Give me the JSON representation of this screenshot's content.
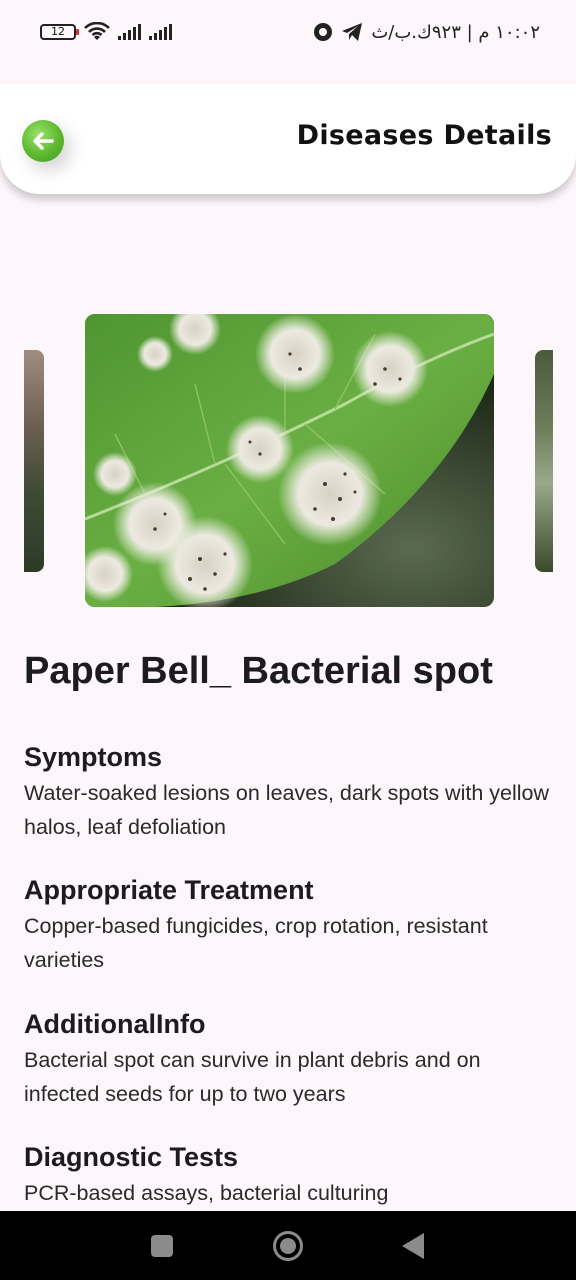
{
  "status_bar": {
    "battery": "12",
    "time_text": "١٠:٠٢ م | ٩٢٣ك.ب/ث",
    "icons": [
      "battery-icon",
      "wifi-icon",
      "signal-icon",
      "signal-icon",
      "vpn-icon",
      "telegram-icon"
    ]
  },
  "header": {
    "title": "Diseases Details",
    "back_icon": "arrow-left-icon",
    "accent": "#5cb82e"
  },
  "carousel": {
    "main_image": "leaf-disease-photo",
    "colors": {
      "leaf": "#5c9e3a",
      "spot": "#e8e6dc",
      "background": "#1e2a18"
    }
  },
  "disease": {
    "name": "Paper Bell_ Bacterial spot",
    "sections": [
      {
        "heading": "Symptoms",
        "text": "Water-soaked lesions on leaves, dark spots with yellow halos, leaf defoliation"
      },
      {
        "heading": "Appropriate Treatment",
        "text": "Copper-based fungicides, crop rotation, resistant varieties"
      },
      {
        "heading": "AdditionalInfo",
        "text": "Bacterial spot can survive in plant debris and on infected seeds for up to two years"
      },
      {
        "heading": "Diagnostic Tests",
        "text": "PCR-based assays, bacterial culturing"
      }
    ]
  },
  "nav_bar": {
    "icons": [
      "recents-square-icon",
      "home-circle-icon",
      "back-triangle-icon"
    ]
  }
}
